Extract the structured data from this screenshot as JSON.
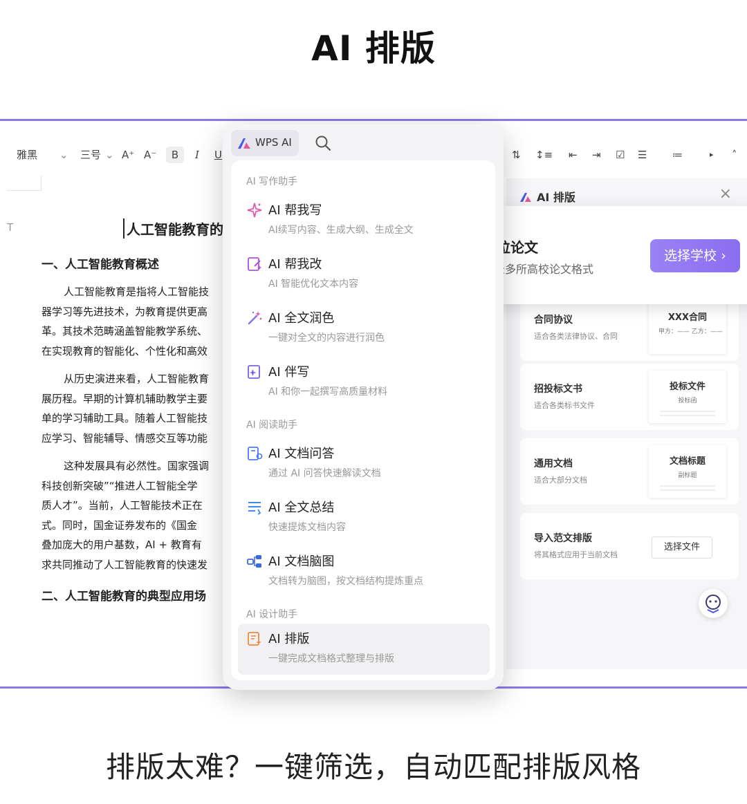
{
  "hero": {
    "title": "AI 排版"
  },
  "toolbar": {
    "font": "雅黑",
    "size": "三号",
    "grow": "A⁺",
    "shrink": "A⁻",
    "bold": "B",
    "italic": "I",
    "underline": "U"
  },
  "document": {
    "marker": "T",
    "title": "人工智能教育的",
    "heading1": "一、人工智能教育概述",
    "para1": [
      "人工智能教育是指将人工智能技",
      "器学习等先进技术，为教育提供更高",
      "革。其技术范畴涵盖智能教学系统、",
      "在实现教育的智能化、个性化和高效"
    ],
    "para2": [
      "从历史演进来看，人工智能教育",
      "展历程。早期的计算机辅助教学主要",
      "单的学习辅助工具。随着人工智能技",
      "应学习、智能辅导、情感交互等功能"
    ],
    "para3": [
      "这种发展具有必然性。国家强调",
      "科技创新突破”“推进人工智能全学",
      "质人才”。当前，人工智能技术正在",
      "式。同时，国金证券发布的《国金",
      "叠加庞大的用户基数，AI + 教育有",
      "求共同推动了人工智能教育的快速发"
    ],
    "heading2": "二、人工智能教育的典型应用场"
  },
  "menu": {
    "brand": "WPS AI",
    "sections": {
      "writing": "AI 写作助手",
      "reading": "AI 阅读助手",
      "design": "AI 设计助手"
    },
    "items": [
      {
        "label": "AI 帮我写",
        "desc": "AI续写内容、生成大纲、生成全文",
        "icon": "sparkle-icon",
        "color": "#e05ab0"
      },
      {
        "label": "AI 帮我改",
        "desc": "AI 智能优化文本内容",
        "icon": "edit-doc-icon",
        "color": "#b04ee0"
      },
      {
        "label": "AI 全文润色",
        "desc": "一键对全文的内容进行润色",
        "icon": "magic-wand-icon",
        "color": "#8a6ef0"
      },
      {
        "label": "AI 伴写",
        "desc": "AI 和你一起撰写高质量材料",
        "icon": "co-write-icon",
        "color": "#7a5ef0"
      },
      {
        "label": "AI 文档问答",
        "desc": "通过 AI 问答快速解读文档",
        "icon": "doc-qa-icon",
        "color": "#4a7af0"
      },
      {
        "label": "AI 全文总结",
        "desc": "快速提炼文档内容",
        "icon": "summary-icon",
        "color": "#3a8af0"
      },
      {
        "label": "AI 文档脑图",
        "desc": "文档转为脑图，按文档结构提炼重点",
        "icon": "mindmap-icon",
        "color": "#3a6ae0"
      },
      {
        "label": "AI 排版",
        "desc": "一键完成文档格式整理与排版",
        "icon": "layout-icon",
        "color": "#f08a3a"
      }
    ]
  },
  "panel": {
    "title": "AI 排版",
    "close": "×",
    "templates": [
      {
        "name": "合同协议",
        "desc": "适合各类法律协议、合同",
        "preview_title": "XXX合同",
        "preview_sub": "甲方：——  乙方：——"
      },
      {
        "name": "招投标文书",
        "desc": "适合各类标书文件",
        "preview_title": "投标文件",
        "preview_sub": "投标函"
      },
      {
        "name": "通用文档",
        "desc": "适合大部分文档",
        "preview_title": "文档标题",
        "preview_sub": "副标题"
      },
      {
        "name": "导入范文排版",
        "desc": "将其格式应用于当前文档",
        "button": "选择文件"
      }
    ]
  },
  "popover": {
    "title": "学位论文",
    "desc": "收录多所高校论文格式",
    "button": "选择学校 ›"
  },
  "caption": "排版太难？一键筛选，自动匹配排版风格",
  "colors": {
    "frame": "#8a78e8",
    "accent": "#8a6ef0"
  }
}
